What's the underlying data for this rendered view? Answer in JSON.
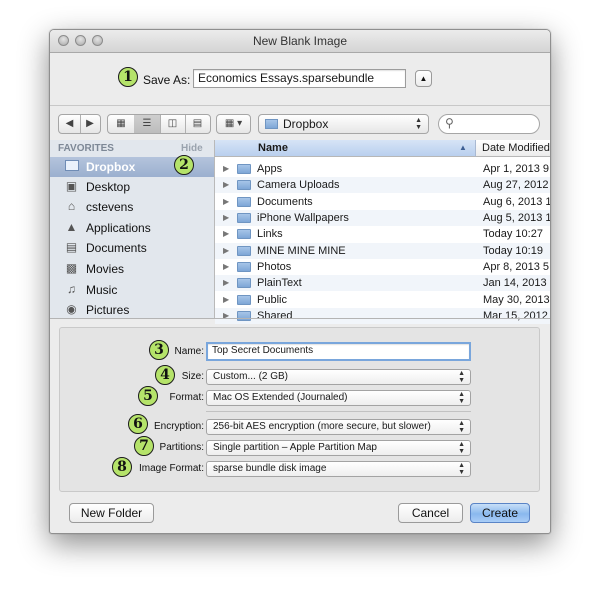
{
  "window": {
    "title": "New Blank Image"
  },
  "save_as": {
    "label": "Save As:",
    "value": "Economics Essays.sparsebundle",
    "expand_icon": "triangle-up-icon"
  },
  "toolbar": {
    "location": "Dropbox",
    "search_placeholder": ""
  },
  "sidebar": {
    "header": "FAVORITES",
    "hide_label": "Hide",
    "items": [
      {
        "label": "Dropbox",
        "icon": "folder-icon",
        "selected": true
      },
      {
        "label": "Desktop",
        "icon": "desktop-icon"
      },
      {
        "label": "cstevens",
        "icon": "home-icon"
      },
      {
        "label": "Applications",
        "icon": "applications-icon"
      },
      {
        "label": "Documents",
        "icon": "documents-icon"
      },
      {
        "label": "Movies",
        "icon": "movies-icon"
      },
      {
        "label": "Music",
        "icon": "music-icon"
      },
      {
        "label": "Pictures",
        "icon": "pictures-icon"
      }
    ]
  },
  "file_list": {
    "columns": [
      "Name",
      "Date Modified"
    ],
    "rows": [
      {
        "name": "Apps",
        "date": "Apr 1, 2013 9"
      },
      {
        "name": "Camera Uploads",
        "date": "Aug 27, 2012"
      },
      {
        "name": "Documents",
        "date": "Aug 6, 2013 1"
      },
      {
        "name": "iPhone Wallpapers",
        "date": "Aug 5, 2013 1"
      },
      {
        "name": "Links",
        "date": "Today 10:27"
      },
      {
        "name": "MINE MINE MINE",
        "date": "Today 10:19"
      },
      {
        "name": "Photos",
        "date": "Apr 8, 2013 5"
      },
      {
        "name": "PlainText",
        "date": "Jan 14, 2013"
      },
      {
        "name": "Public",
        "date": "May 30, 2013"
      },
      {
        "name": "Shared",
        "date": "Mar 15, 2012"
      }
    ]
  },
  "options": {
    "name_label": "Name:",
    "name_value": "Top Secret Documents",
    "size_label": "Size:",
    "size_value": "Custom... (2 GB)",
    "format_label": "Format:",
    "format_value": "Mac OS Extended (Journaled)",
    "encryption_label": "Encryption:",
    "encryption_value": "256-bit AES encryption (more secure, but slower)",
    "partitions_label": "Partitions:",
    "partitions_value": "Single partition – Apple Partition Map",
    "image_format_label": "Image Format:",
    "image_format_value": "sparse bundle disk image"
  },
  "buttons": {
    "new_folder": "New Folder",
    "cancel": "Cancel",
    "create": "Create"
  },
  "callouts": [
    "1",
    "2",
    "3",
    "4",
    "5",
    "6",
    "7",
    "8"
  ],
  "colors": {
    "callout_fill": "#b5e36a",
    "selection": "#a4b8d6",
    "default_button": "#8ab8ee"
  }
}
